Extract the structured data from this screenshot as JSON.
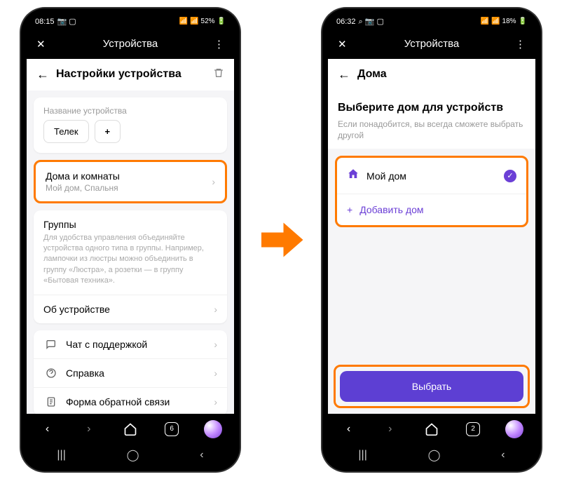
{
  "phone1": {
    "status": {
      "time": "08:15",
      "battery": "52%",
      "sig_icons": "📷 ⬚"
    },
    "header": {
      "title": "Устройства"
    },
    "page_title": "Настройки устройства",
    "device_name_label": "Название устройства",
    "device_name_value": "Телек",
    "rows": {
      "rooms": {
        "title": "Дома и комнаты",
        "sub": "Мой дом, Спальня"
      },
      "groups": {
        "title": "Группы",
        "desc": "Для удобства управления объединяйте устройства одного типа в группы. Например, лампочки из люстры можно объединить в группу «Люстра», а розетки — в группу «Бытовая техника»."
      },
      "about": {
        "title": "Об устройстве"
      },
      "chat": {
        "title": "Чат с поддержкой"
      },
      "help": {
        "title": "Справка"
      },
      "feedback": {
        "title": "Форма обратной связи"
      }
    },
    "tab_count": "6"
  },
  "phone2": {
    "status": {
      "time": "06:32",
      "battery": "18%",
      "sig_icons": "⌕ 📷 ⬚"
    },
    "header": {
      "title": "Устройства"
    },
    "page_title": "Дома",
    "intro": {
      "title": "Выберите дом для устройств",
      "sub": "Если понадобится, вы всегда сможете выбрать другой"
    },
    "home": {
      "name": "Мой дом"
    },
    "add": "Добавить дом",
    "button": "Выбрать",
    "tab_count": "2"
  }
}
